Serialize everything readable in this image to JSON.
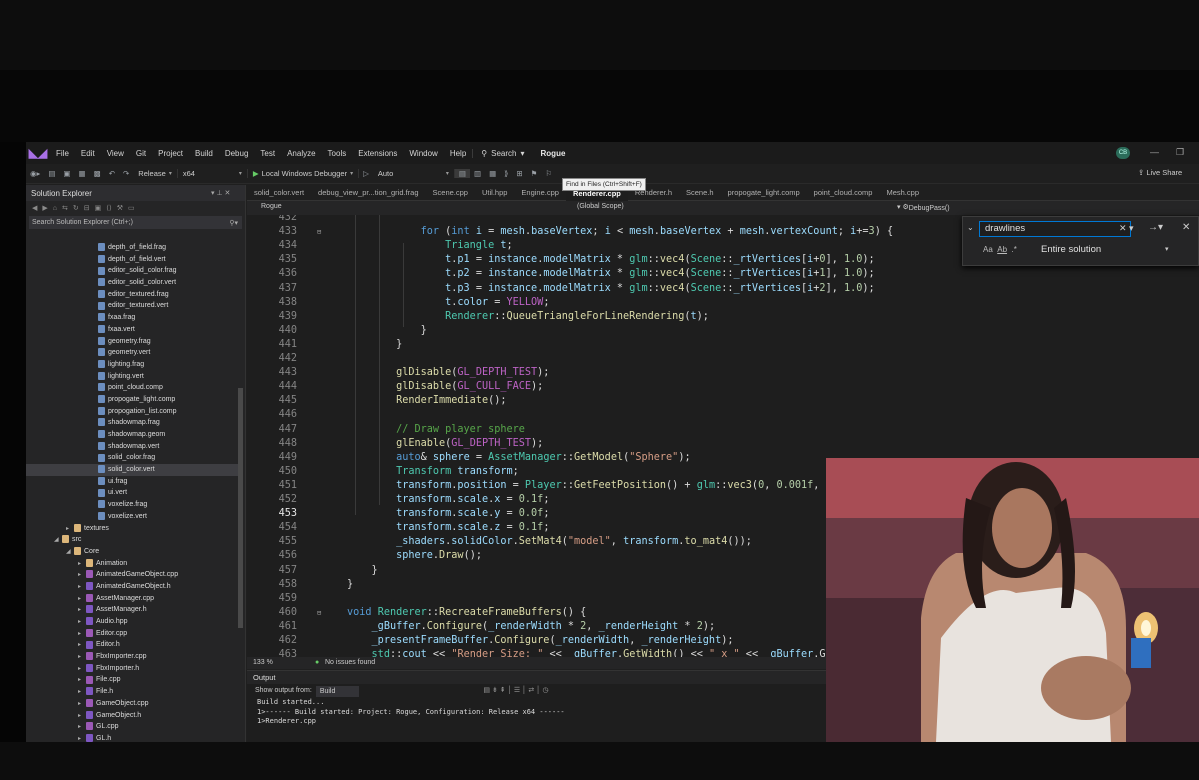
{
  "menu": {
    "items": [
      "File",
      "Edit",
      "View",
      "Git",
      "Project",
      "Build",
      "Debug",
      "Test",
      "Analyze",
      "Tools",
      "Extensions",
      "Window",
      "Help"
    ],
    "search_label": "Search",
    "project_name": "Rogue",
    "avatar_initials": "CB"
  },
  "toolbar": {
    "config": "Release",
    "platform": "x64",
    "debugger": "Local Windows Debugger",
    "mode": "Auto",
    "tooltip": "Find in Files (Ctrl+Shift+F)",
    "live_share": "Live Share"
  },
  "solution_explorer": {
    "title": "Solution Explorer",
    "search_placeholder": "Search Solution Explorer (Ctrl+;)",
    "items": [
      {
        "label": "depth_of_field.frag",
        "depth": 5,
        "kind": "file"
      },
      {
        "label": "depth_of_field.vert",
        "depth": 5,
        "kind": "file"
      },
      {
        "label": "editor_solid_color.frag",
        "depth": 5,
        "kind": "file"
      },
      {
        "label": "editor_solid_color.vert",
        "depth": 5,
        "kind": "file"
      },
      {
        "label": "editor_textured.frag",
        "depth": 5,
        "kind": "file"
      },
      {
        "label": "editor_textured.vert",
        "depth": 5,
        "kind": "file"
      },
      {
        "label": "fxaa.frag",
        "depth": 5,
        "kind": "file"
      },
      {
        "label": "fxaa.vert",
        "depth": 5,
        "kind": "file"
      },
      {
        "label": "geometry.frag",
        "depth": 5,
        "kind": "file"
      },
      {
        "label": "geometry.vert",
        "depth": 5,
        "kind": "file"
      },
      {
        "label": "lighting.frag",
        "depth": 5,
        "kind": "file"
      },
      {
        "label": "lighting.vert",
        "depth": 5,
        "kind": "file"
      },
      {
        "label": "point_cloud.comp",
        "depth": 5,
        "kind": "file"
      },
      {
        "label": "propogate_light.comp",
        "depth": 5,
        "kind": "file"
      },
      {
        "label": "propogation_list.comp",
        "depth": 5,
        "kind": "file"
      },
      {
        "label": "shadowmap.frag",
        "depth": 5,
        "kind": "file"
      },
      {
        "label": "shadowmap.geom",
        "depth": 5,
        "kind": "file"
      },
      {
        "label": "shadowmap.vert",
        "depth": 5,
        "kind": "file"
      },
      {
        "label": "solid_color.frag",
        "depth": 5,
        "kind": "file"
      },
      {
        "label": "solid_color.vert",
        "depth": 5,
        "kind": "file",
        "selected": true
      },
      {
        "label": "ui.frag",
        "depth": 5,
        "kind": "file"
      },
      {
        "label": "ui.vert",
        "depth": 5,
        "kind": "file"
      },
      {
        "label": "voxelize.frag",
        "depth": 5,
        "kind": "file"
      },
      {
        "label": "voxelize.vert",
        "depth": 5,
        "kind": "file"
      },
      {
        "label": "textures",
        "depth": 3,
        "kind": "folder",
        "arrow": "▸"
      },
      {
        "label": "src",
        "depth": 2,
        "kind": "folder",
        "arrow": "◢"
      },
      {
        "label": "Core",
        "depth": 3,
        "kind": "folder",
        "arrow": "◢"
      },
      {
        "label": "Animation",
        "depth": 4,
        "kind": "folder",
        "arrow": "▸"
      },
      {
        "label": "AnimatedGameObject.cpp",
        "depth": 4,
        "kind": "cpp",
        "arrow": "▸"
      },
      {
        "label": "AnimatedGameObject.h",
        "depth": 4,
        "kind": "h",
        "arrow": "▸"
      },
      {
        "label": "AssetManager.cpp",
        "depth": 4,
        "kind": "cpp",
        "arrow": "▸"
      },
      {
        "label": "AssetManager.h",
        "depth": 4,
        "kind": "h",
        "arrow": "▸"
      },
      {
        "label": "Audio.hpp",
        "depth": 4,
        "kind": "h",
        "arrow": "▸"
      },
      {
        "label": "Editor.cpp",
        "depth": 4,
        "kind": "cpp",
        "arrow": "▸"
      },
      {
        "label": "Editor.h",
        "depth": 4,
        "kind": "h",
        "arrow": "▸"
      },
      {
        "label": "FbxImporter.cpp",
        "depth": 4,
        "kind": "cpp",
        "arrow": "▸"
      },
      {
        "label": "FbxImporter.h",
        "depth": 4,
        "kind": "h",
        "arrow": "▸"
      },
      {
        "label": "File.cpp",
        "depth": 4,
        "kind": "cpp",
        "arrow": "▸"
      },
      {
        "label": "File.h",
        "depth": 4,
        "kind": "h",
        "arrow": "▸"
      },
      {
        "label": "GameObject.cpp",
        "depth": 4,
        "kind": "cpp",
        "arrow": "▸"
      },
      {
        "label": "GameObject.h",
        "depth": 4,
        "kind": "h",
        "arrow": "▸"
      },
      {
        "label": "GL.cpp",
        "depth": 4,
        "kind": "cpp",
        "arrow": "▸"
      },
      {
        "label": "GL.h",
        "depth": 4,
        "kind": "h",
        "arrow": "▸"
      }
    ]
  },
  "tabs": [
    "solid_color.vert",
    "debug_view_pr...tion_grid.frag",
    "Scene.cpp",
    "Util.hpp",
    "Engine.cpp",
    "Renderer.cpp",
    "Renderer.h",
    "Scene.h",
    "propogate_light.comp",
    "point_cloud.comp",
    "Mesh.cpp"
  ],
  "active_tab": "Renderer.cpp",
  "navbar": {
    "project": "Rogue",
    "scope": "(Global Scope)",
    "member": "DebugPass()"
  },
  "find": {
    "query": "drawlines",
    "scope": "Entire solution"
  },
  "code": {
    "current_line": "453",
    "lines": [
      {
        "n": "432",
        "t": ""
      },
      {
        "n": "433",
        "t": "            for (int i = mesh.baseVertex; i < mesh.baseVertex + mesh.vertexCount; i+=3) {"
      },
      {
        "n": "434",
        "t": "                Triangle t;"
      },
      {
        "n": "435",
        "t": "                t.p1 = instance.modelMatrix * glm::vec4(Scene::_rtVertices[i+0], 1.0);"
      },
      {
        "n": "436",
        "t": "                t.p2 = instance.modelMatrix * glm::vec4(Scene::_rtVertices[i+1], 1.0);"
      },
      {
        "n": "437",
        "t": "                t.p3 = instance.modelMatrix * glm::vec4(Scene::_rtVertices[i+2], 1.0);"
      },
      {
        "n": "438",
        "t": "                t.color = YELLOW;"
      },
      {
        "n": "439",
        "t": "                Renderer::QueueTriangleForLineRendering(t);"
      },
      {
        "n": "440",
        "t": "            }"
      },
      {
        "n": "441",
        "t": "        }"
      },
      {
        "n": "442",
        "t": ""
      },
      {
        "n": "443",
        "t": "        glDisable(GL_DEPTH_TEST);"
      },
      {
        "n": "444",
        "t": "        glDisable(GL_CULL_FACE);"
      },
      {
        "n": "445",
        "t": "        RenderImmediate();"
      },
      {
        "n": "446",
        "t": ""
      },
      {
        "n": "447",
        "t": "        // Draw player sphere"
      },
      {
        "n": "448",
        "t": "        glEnable(GL_DEPTH_TEST);"
      },
      {
        "n": "449",
        "t": "        auto& sphere = AssetManager::GetModel(\"Sphere\");"
      },
      {
        "n": "450",
        "t": "        Transform transform;"
      },
      {
        "n": "451",
        "t": "        transform.position = Player::GetFeetPosition() + glm::vec3(0, 0.001f, 0"
      },
      {
        "n": "452",
        "t": "        transform.scale.x = 0.1f;"
      },
      {
        "n": "453",
        "t": "        transform.scale.y = 0.0f;"
      },
      {
        "n": "454",
        "t": "        transform.scale.z = 0.1f;"
      },
      {
        "n": "455",
        "t": "        _shaders.solidColor.SetMat4(\"model\", transform.to_mat4());"
      },
      {
        "n": "456",
        "t": "        sphere.Draw();"
      },
      {
        "n": "457",
        "t": "    }"
      },
      {
        "n": "458",
        "t": "}"
      },
      {
        "n": "459",
        "t": ""
      },
      {
        "n": "460",
        "t": "void Renderer::RecreateFrameBuffers() {"
      },
      {
        "n": "461",
        "t": "    _gBuffer.Configure(_renderWidth * 2, _renderHeight * 2);"
      },
      {
        "n": "462",
        "t": "    _presentFrameBuffer.Configure(_renderWidth, _renderHeight);"
      },
      {
        "n": "463",
        "t": "    std::cout << \"Render Size: \" << _gBuffer.GetWidth() << \" x \" << _gBuffer.G"
      }
    ]
  },
  "editor_status": {
    "zoom": "133 %",
    "issues": "No issues found"
  },
  "output": {
    "title": "Output",
    "show_from_label": "Show output from:",
    "source": "Build",
    "lines": [
      "Build started...",
      "1>------ Build started: Project: Rogue, Configuration: Release x64 ------",
      "1>Renderer.cpp"
    ]
  },
  "colors": {
    "accent": "#a970e6",
    "keyword": "#569cd6",
    "function": "#dcdcaa",
    "type": "#4ec9b0",
    "variable": "#9cdcfe",
    "number": "#b5cea8",
    "string": "#d69d85",
    "comment": "#57a64a",
    "macro": "#bd63c5"
  }
}
